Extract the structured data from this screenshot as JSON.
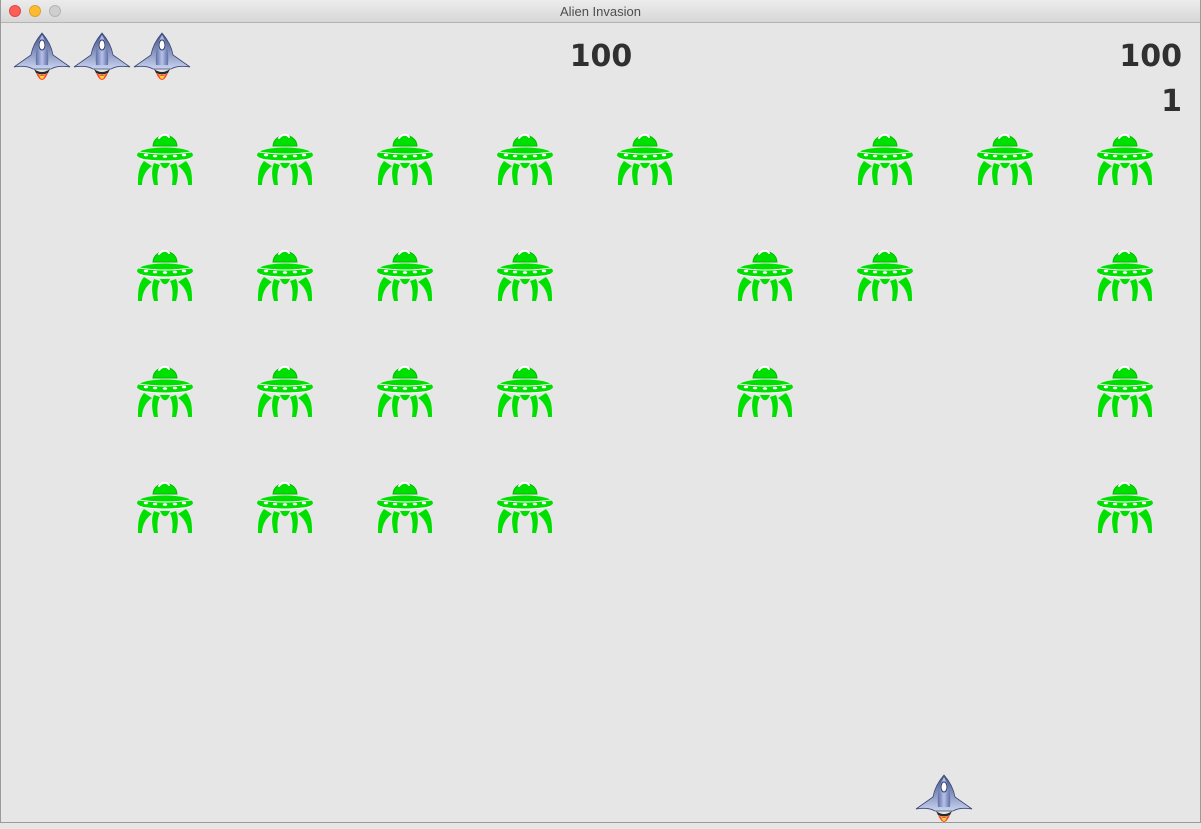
{
  "window": {
    "title": "Alien Invasion"
  },
  "scoreboard": {
    "score": "100",
    "high_score": "100",
    "level": "1"
  },
  "lives": [
    "ship-icon",
    "ship-icon",
    "ship-icon"
  ],
  "colors": {
    "background": "#e6e6e6",
    "alien": "#00e600",
    "text": "#303030",
    "ship_body": "#7f8fc0",
    "ship_flame": "#ff5a1e"
  },
  "alien_grid": [
    [
      1,
      1,
      1,
      1,
      1,
      0,
      1,
      1,
      1
    ],
    [
      1,
      1,
      1,
      1,
      0,
      1,
      1,
      0,
      1
    ],
    [
      1,
      1,
      1,
      1,
      0,
      1,
      0,
      0,
      1
    ],
    [
      1,
      1,
      1,
      1,
      0,
      0,
      0,
      0,
      1
    ]
  ],
  "player_ship": {
    "icon": "ship-icon"
  }
}
